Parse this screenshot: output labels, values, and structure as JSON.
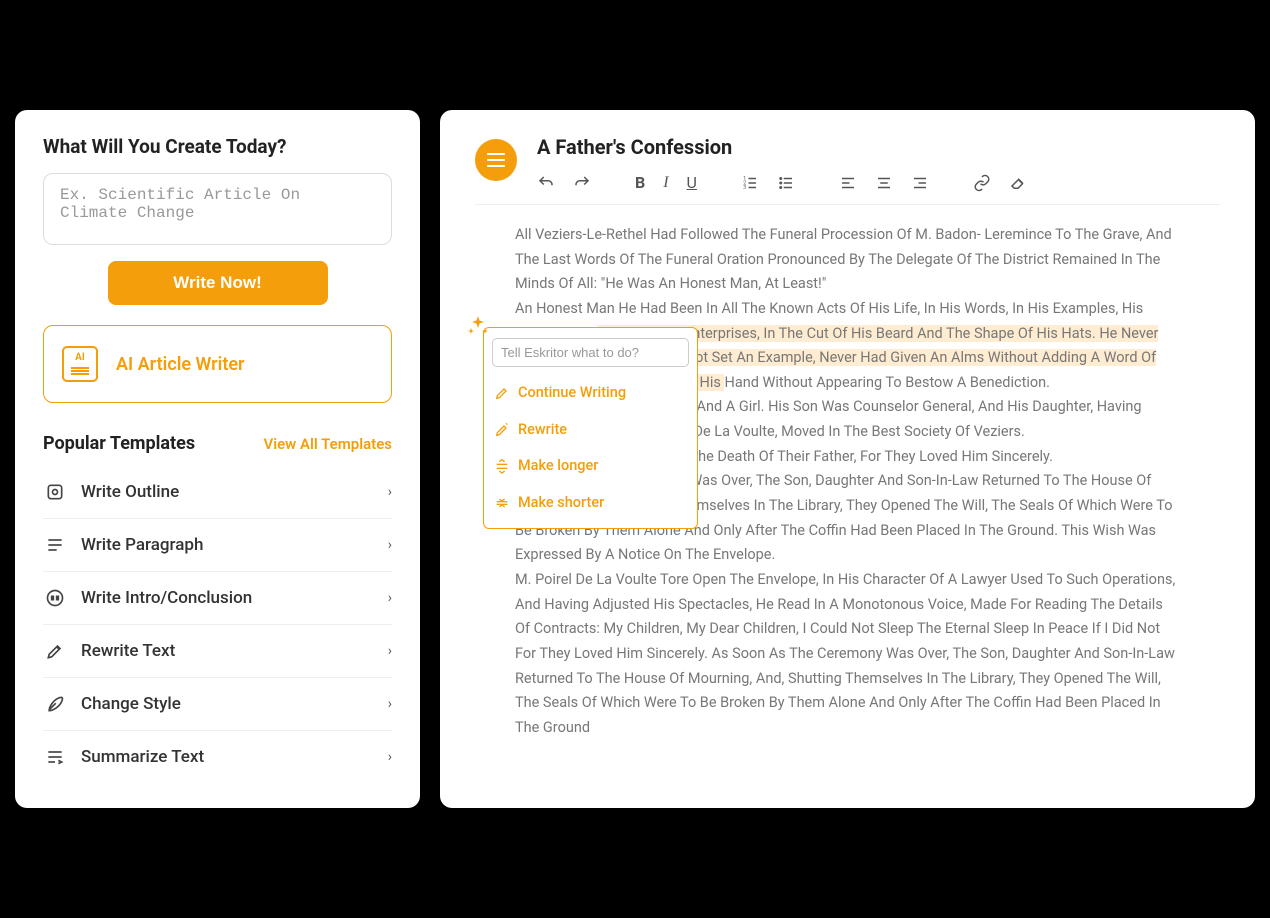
{
  "left": {
    "heading": "What Will You Create Today?",
    "input_placeholder": "Ex. Scientific Article On Climate Change",
    "write_btn": "Write Now!",
    "ai_writer": "AI Article Writer",
    "templates_title": "Popular Templates",
    "view_all": "View All Templates",
    "templates": [
      {
        "label": "Write Outline"
      },
      {
        "label": "Write Paragraph"
      },
      {
        "label": "Write Intro/Conclusion"
      },
      {
        "label": "Rewrite Text"
      },
      {
        "label": "Change Style"
      },
      {
        "label": "Summarize Text"
      }
    ]
  },
  "right": {
    "title": "A Father's Confession",
    "p1": "All Veziers-Le-Rethel Had Followed The Funeral Procession Of M. Badon- Leremince To The Grave, And The Last Words Of The Funeral Oration Pronounced By The Delegate Of The District Remained In The Minds Of All: \"He Was An Honest Man, At Least!\"",
    "p2a": "An Honest Man He Had Been In All The Known Acts Of His Life, In His Words, In His Examples, His Attitude, His ",
    "p2b": "Behavior, His Enterprises, In The Cut Of His Beard And The Shape Of His Hats. He Never Had Said A Word That Did Not Set An Example, Never Had Given An Alms Without Adding A Word Of Advice, Never Had Extended His ",
    "p2c": "Hand Without Appearing To Bestow A Benediction.",
    "p3": "He Left Two Children, A Boy And A Girl. His Son Was Counselor General, And His Daughter, Having Married A Lawyer, M. Poirel De La Voulte, Moved In The Best Society Of Veziers.",
    "p4": "They Were Inconsolable At The Death Of Their Father, For They Loved Him Sincerely.",
    "p5": "As Soon As The Ceremony Was Over, The Son, Daughter And Son-In-Law Returned To The House Of Mourning, And, Shutting Themselves In The Library, They Opened The Will, The Seals Of Which Were To Be Broken By Them Alone And Only After The Coffin Had Been Placed In The Ground. This Wish Was Expressed By A Notice On The Envelope.",
    "p6": "M. Poirel De La Voulte Tore Open The Envelope, In His Character Of A Lawyer Used To Such Operations, And Having Adjusted His Spectacles, He Read In A Monotonous Voice, Made For Reading The Details Of Contracts: My Children, My Dear Children, I Could Not Sleep The Eternal Sleep In Peace If I Did Not For They Loved Him Sincerely. As Soon As The Ceremony Was Over, The Son, Daughter And Son-In-Law Returned To The House Of Mourning, And, Shutting Themselves In The Library, They Opened The Will, The Seals Of Which Were To Be Broken By Them Alone And Only After The Coffin Had Been Placed In The Ground"
  },
  "popup": {
    "placeholder": "Tell Eskritor what to do?",
    "items": [
      "Continue Writing",
      "Rewrite",
      "Make longer",
      "Make shorter"
    ]
  }
}
